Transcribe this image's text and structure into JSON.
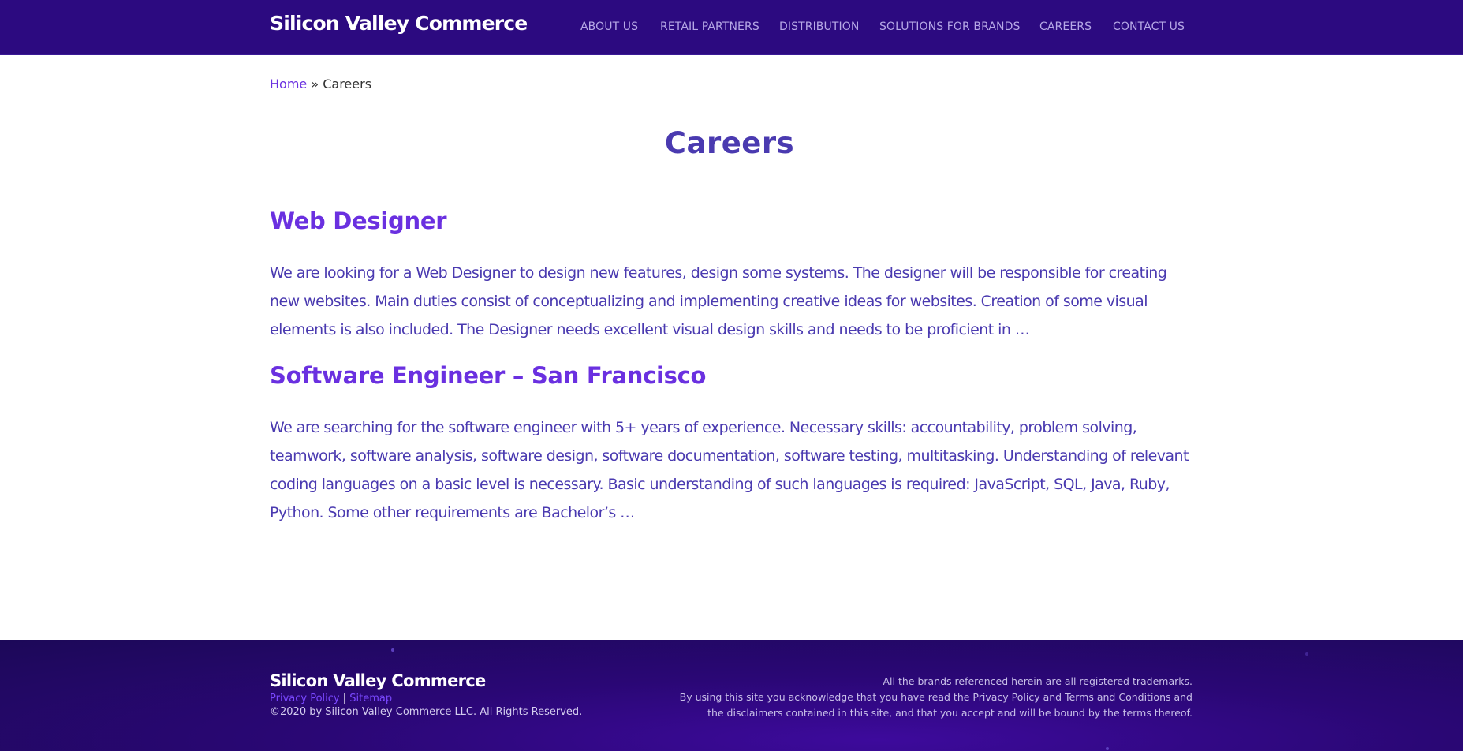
{
  "header": {
    "brand": "Silicon Valley Commerce",
    "nav": [
      {
        "label": "ABOUT US"
      },
      {
        "label": "RETAIL PARTNERS"
      },
      {
        "label": "DISTRIBUTION"
      },
      {
        "label": "SOLUTIONS FOR BRANDS"
      },
      {
        "label": "CAREERS"
      },
      {
        "label": "CONTACT US"
      }
    ]
  },
  "breadcrumb": {
    "home": "Home",
    "separator": " » ",
    "current": "Careers"
  },
  "page_title": "Careers",
  "jobs": [
    {
      "title": "Web Designer",
      "description": "We are looking for a Web Designer to design new features, design some systems. The designer will be responsible for creating new websites. Main duties consist of conceptualizing and implementing creative ideas for websites. Creation of some visual elements is also included. The Designer needs excellent visual design skills and needs to be proficient in …"
    },
    {
      "title": "Software Engineer – San Francisco",
      "description": "We are searching for the software engineer with 5+ years of experience. Necessary skills: accountability, problem solving, teamwork, software analysis, software design, software documentation, software testing, multitasking. Understanding of relevant coding languages on a basic level is necessary. Basic understanding of such languages is required: JavaScript, SQL, Java, Ruby, Python. Some other requirements are Bachelor’s …"
    }
  ],
  "footer": {
    "brand": "Silicon Valley Commerce",
    "privacy_policy": "Privacy Policy",
    "link_separator": " | ",
    "sitemap": "Sitemap",
    "copyright": "©2020 by Silicon Valley Commerce LLC. All Rights Reserved.",
    "legal_lines": [
      "All the brands referenced herein are all registered trademarks.",
      "By using this site you acknowledge that you have read the Privacy Policy and Terms and Conditions and",
      "the disclaimers contained in this site, and that you accept and will be bound by the terms thereof."
    ]
  },
  "colors": {
    "header_bg": "#2c0a80",
    "accent": "#6a30e0",
    "body_text": "#4a3ab0",
    "footer_bg": "#2a0775"
  }
}
